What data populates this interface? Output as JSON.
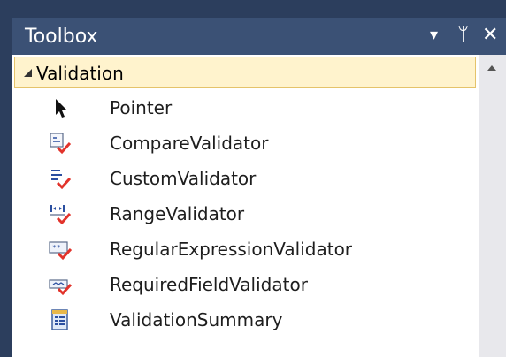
{
  "window": {
    "title": "Toolbox",
    "buttons": {
      "dropdown": "▾",
      "pin": "ᛘ",
      "close": "✕"
    }
  },
  "category": {
    "label": "Validation"
  },
  "items": [
    {
      "label": "Pointer",
      "icon": "pointer-arrow"
    },
    {
      "label": "CompareValidator",
      "icon": "compare-validator"
    },
    {
      "label": "CustomValidator",
      "icon": "custom-validator"
    },
    {
      "label": "RangeValidator",
      "icon": "range-validator"
    },
    {
      "label": "RegularExpressionValidator",
      "icon": "regex-validator"
    },
    {
      "label": "RequiredFieldValidator",
      "icon": "required-field-validator"
    },
    {
      "label": "ValidationSummary",
      "icon": "validation-summary"
    }
  ],
  "colors": {
    "frame": "#2c3e5d",
    "titlebar": "#3b5175",
    "category_bg": "#fff3cd",
    "category_border": "#e5c36a",
    "check": "#e2332b"
  }
}
